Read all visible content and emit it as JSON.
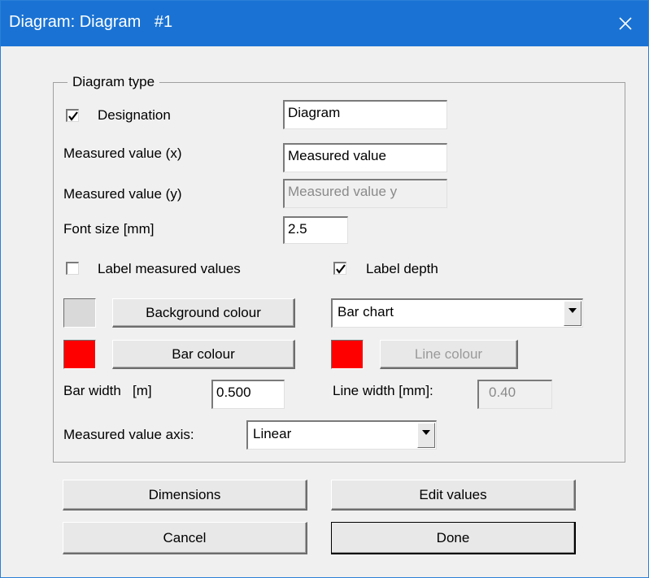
{
  "window": {
    "title": "Diagram: Diagram   #1",
    "close_icon": "close-icon"
  },
  "group": {
    "label": "Diagram type"
  },
  "designation": {
    "checked": true,
    "label": "Designation",
    "value": "Diagram"
  },
  "measured_x": {
    "label": "Measured value (x)",
    "value": "Measured value"
  },
  "measured_y": {
    "label": "Measured value (y)",
    "value": "Measured value y",
    "disabled": true
  },
  "font_size": {
    "label": "Font size [mm]",
    "value": "2.5"
  },
  "label_measured_values": {
    "checked": false,
    "label": "Label measured values"
  },
  "label_depth": {
    "checked": true,
    "label": "Label depth"
  },
  "background": {
    "swatch_color": "#d9d9d9",
    "button_label": "Background colour"
  },
  "chart_type": {
    "selected": "Bar chart"
  },
  "bar": {
    "swatch_color": "#ff0000",
    "button_label": "Bar colour",
    "width_label": "Bar width   [m]",
    "width_value": "0.500"
  },
  "line": {
    "swatch_color": "#ff0000",
    "button_label": "Line colour",
    "button_disabled": true,
    "width_label": "Line width [mm]:",
    "width_value": "0.40",
    "width_disabled": true
  },
  "axis": {
    "label": "Measured value axis:",
    "selected": "Linear"
  },
  "buttons": {
    "dimensions": "Dimensions",
    "edit_values": "Edit values",
    "cancel": "Cancel",
    "done": "Done"
  },
  "colors": {
    "titlebar": "#1a73d4",
    "dialog_bg": "#f0f0f0"
  }
}
